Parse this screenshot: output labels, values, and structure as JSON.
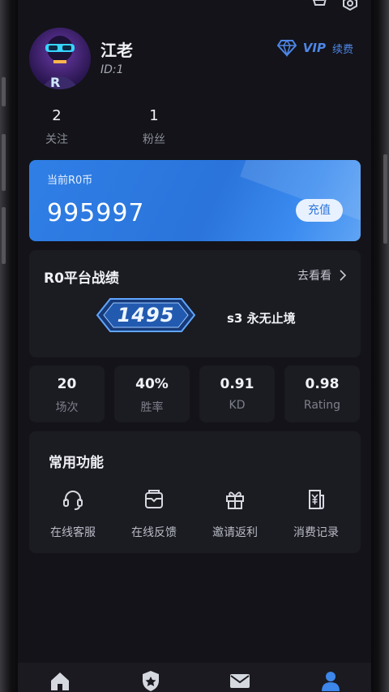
{
  "profile": {
    "name": "江老",
    "id_text": "ID:1",
    "avatar_letter": "R"
  },
  "vip": {
    "label": "VIP",
    "renew": "续费",
    "color": "#4d86e6"
  },
  "stats": [
    {
      "value": "2",
      "label": "关注"
    },
    {
      "value": "1",
      "label": "粉丝"
    }
  ],
  "coin_card": {
    "label": "当前R0币",
    "value": "995997",
    "button": "充值",
    "color": "#2a74db"
  },
  "record": {
    "title": "R0平台战绩",
    "more": "去看看",
    "rating_badge": "1495",
    "season": "s3  永无止境"
  },
  "metrics": [
    {
      "value": "20",
      "label": "场次"
    },
    {
      "value": "40%",
      "label": "胜率"
    },
    {
      "value": "0.91",
      "label": "KD"
    },
    {
      "value": "0.98",
      "label": "Rating"
    }
  ],
  "functions": {
    "title": "常用功能",
    "items": [
      {
        "label": "在线客服",
        "icon": "headset-icon"
      },
      {
        "label": "在线反馈",
        "icon": "feedback-icon"
      },
      {
        "label": "邀请返利",
        "icon": "gift-icon"
      },
      {
        "label": "消费记录",
        "icon": "receipt-icon"
      }
    ]
  },
  "tabbar": {
    "items": [
      {
        "icon": "home-icon"
      },
      {
        "icon": "shield-star-icon"
      },
      {
        "icon": "mail-icon"
      },
      {
        "icon": "profile-icon",
        "active": true
      }
    ],
    "active_color": "#3d86ea"
  }
}
